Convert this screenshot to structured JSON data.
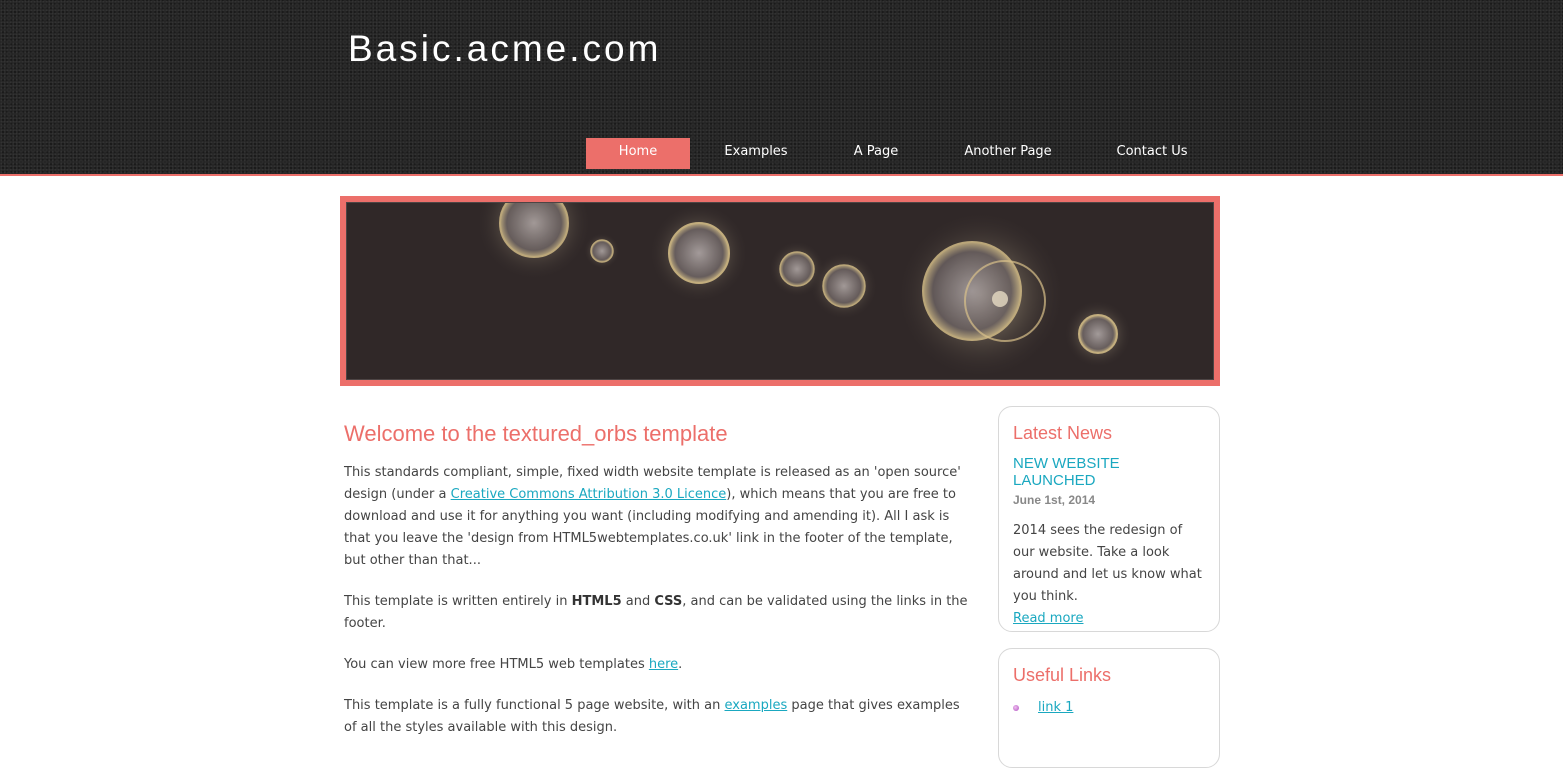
{
  "site": {
    "title": "Basic.acme.com"
  },
  "menu": {
    "items": [
      {
        "label": "Home",
        "selected": true
      },
      {
        "label": "Examples",
        "selected": false
      },
      {
        "label": "A Page",
        "selected": false
      },
      {
        "label": "Another Page",
        "selected": false
      },
      {
        "label": "Contact Us",
        "selected": false
      }
    ]
  },
  "content": {
    "heading": "Welcome to the textured_orbs template",
    "p1": {
      "before": "This standards compliant, simple, fixed width website template is released as an 'open source' design (under a ",
      "link": "Creative Commons Attribution 3.0 Licence",
      "after": "), which means that you are free to download and use it for anything you want (including modifying and amending it). All I ask is that you leave the 'design from HTML5webtemplates.co.uk' link in the footer of the template, but other than that..."
    },
    "p2": {
      "before": "This template is written entirely in ",
      "bold1": "HTML5",
      "mid": " and ",
      "bold2": "CSS",
      "after": ", and can be validated using the links in the footer."
    },
    "p3": {
      "before": "You can view more free HTML5 web templates ",
      "link": "here",
      "after": "."
    },
    "p4": {
      "before": "This template is a fully functional 5 page website, with an ",
      "link": "examples",
      "after": " page that gives examples of all the styles available with this design."
    }
  },
  "sidebar": {
    "news": {
      "heading": "Latest News",
      "title": "NEW WEBSITE LAUNCHED",
      "date": "June 1st, 2014",
      "body": "2014 sees the redesign of our website. Take a look around and let us know what you think.",
      "read_more": "Read more"
    },
    "links": {
      "heading": "Useful Links",
      "items": [
        "link 1"
      ]
    }
  },
  "colors": {
    "accent": "#ec6f6a",
    "link": "#1aa8c0",
    "header_bg": "#232323",
    "banner_bg": "#302828"
  }
}
